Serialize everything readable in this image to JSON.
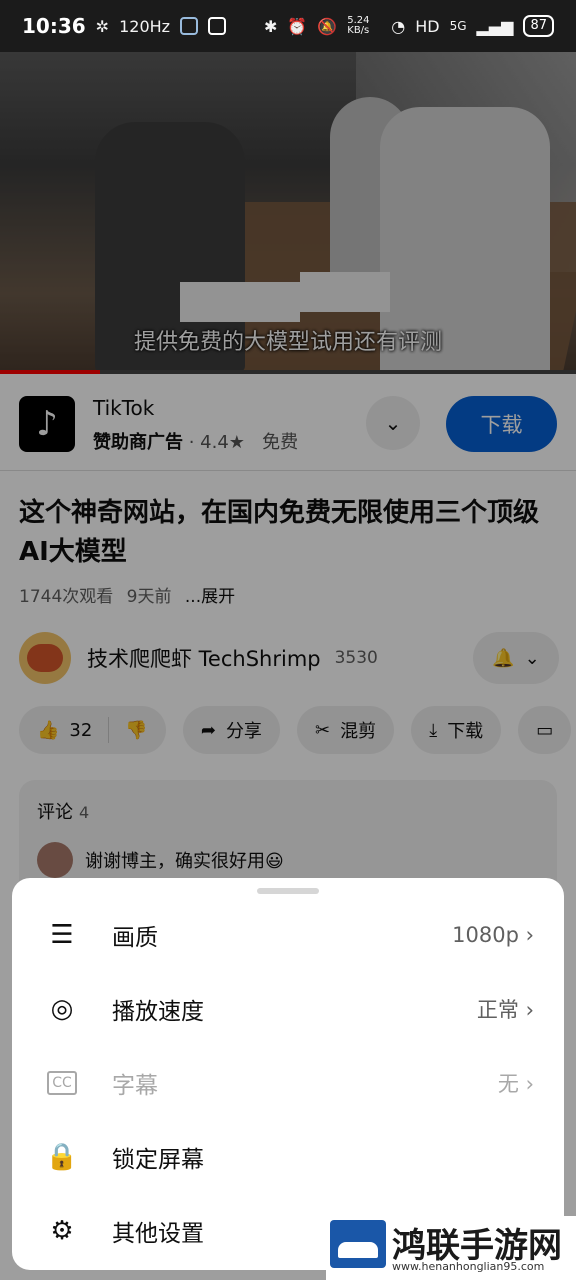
{
  "status_bar": {
    "time": "10:36",
    "refresh_rate": "120Hz",
    "net_speed": "5.24 KB/s",
    "network": "5G",
    "battery": "87"
  },
  "video": {
    "caption": "提供免费的大模型试用还有评测"
  },
  "ad": {
    "app_name": "TikTok",
    "sponsor": "赞助商广告",
    "rating": "4.4★",
    "price": "免费",
    "download_label": "下载"
  },
  "video_info": {
    "title": "这个神奇网站，在国内免费无限使用三个顶级AI大模型",
    "views": "1744次观看",
    "age": "9天前",
    "expand": "...展开"
  },
  "channel": {
    "name": "技术爬爬虾  TechShrimp",
    "subscribers": "3530"
  },
  "actions": {
    "likes": "32",
    "share": "分享",
    "remix": "混剪",
    "download": "下载"
  },
  "comments": {
    "title": "评论",
    "count": "4",
    "top_comment": "谢谢博主，确实很好用😃"
  },
  "sheet": {
    "items": [
      {
        "label": "画质",
        "value": "1080p",
        "icon": "sliders-icon"
      },
      {
        "label": "播放速度",
        "value": "正常",
        "icon": "playback-speed-icon"
      },
      {
        "label": "字幕",
        "value": "无",
        "icon": "cc-icon"
      },
      {
        "label": "锁定屏幕",
        "value": "",
        "icon": "lock-icon"
      },
      {
        "label": "其他设置",
        "value": "",
        "icon": "gear-icon"
      }
    ]
  },
  "watermark": {
    "name": "鸿联手游网",
    "url": "www.henanhonglian95.com"
  }
}
